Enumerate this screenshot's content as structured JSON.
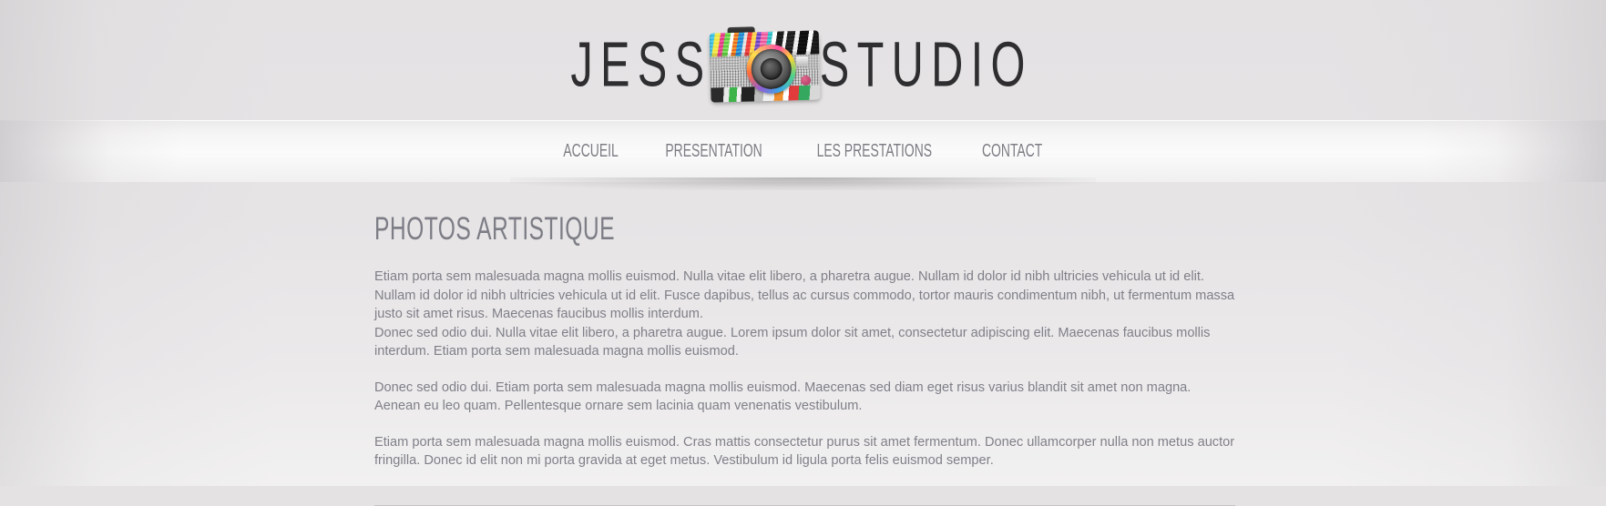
{
  "site": {
    "logo_left": "JESS",
    "logo_right": "STUDIO",
    "logo_icon": "vintage-camera-collage"
  },
  "nav": {
    "items": [
      {
        "label": "ACCUEIL"
      },
      {
        "label": "PRESENTATION"
      },
      {
        "label": "LES PRESTATIONS"
      },
      {
        "label": "CONTACT"
      }
    ]
  },
  "main": {
    "title": "PHOTOS ARTISTIQUE",
    "paragraphs": [
      "Etiam porta sem malesuada magna mollis euismod. Nulla vitae elit libero, a pharetra augue. Nullam id dolor id nibh ultricies vehicula ut id elit. Nullam id dolor id nibh ultricies vehicula ut id elit. Fusce dapibus, tellus ac cursus commodo, tortor mauris condimentum nibh, ut fermentum massa justo sit amet risus. Maecenas faucibus mollis interdum.",
      "Donec sed odio dui. Nulla vitae elit libero, a pharetra augue. Lorem ipsum dolor sit amet, consectetur adipiscing elit. Maecenas faucibus mollis interdum. Etiam porta sem malesuada magna mollis euismod.",
      "Donec sed odio dui. Etiam porta sem malesuada magna mollis euismod. Maecenas sed diam eget risus varius blandit sit amet non magna. Aenean eu leo quam. Pellentesque ornare sem lacinia quam venenatis vestibulum.",
      "Etiam porta sem malesuada magna mollis euismod. Cras mattis consectetur purus sit amet fermentum. Donec ullamcorper nulla non metus auctor fringilla. Donec id elit non mi porta gravida at eget metus. Vestibulum id ligula porta felis euismod semper."
    ]
  },
  "colors": {
    "background": "#e4e2e3",
    "nav_band": "#fbfbfb",
    "text": "#7f7f88",
    "logo_text": "#2e2e30",
    "divider": "#aaa8ac"
  }
}
